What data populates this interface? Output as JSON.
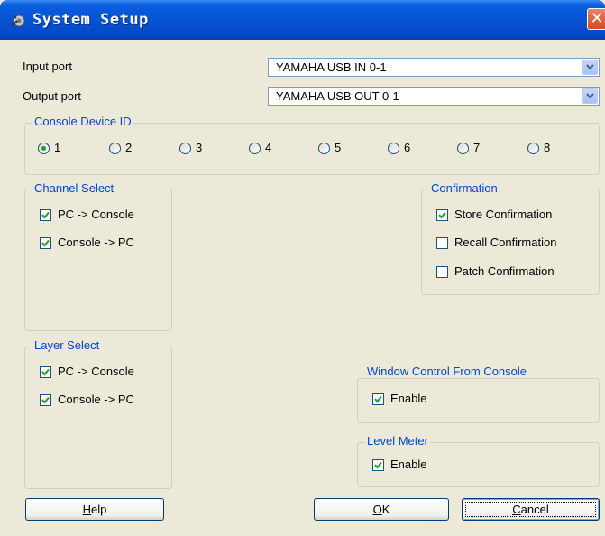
{
  "window": {
    "title": "System Setup",
    "close_glyph": "✕",
    "icon": "system-setup-icon"
  },
  "ports": {
    "input_label": "Input port",
    "input_value": "YAMAHA USB IN 0-1",
    "output_label": "Output port",
    "output_value": "YAMAHA USB OUT 0-1"
  },
  "console_device_id": {
    "title": "Console Device ID",
    "options": [
      "1",
      "2",
      "3",
      "4",
      "5",
      "6",
      "7",
      "8"
    ],
    "selected": "1"
  },
  "channel_select": {
    "title": "Channel Select",
    "items": [
      {
        "label": "PC -> Console",
        "checked": true
      },
      {
        "label": "Console -> PC",
        "checked": true
      }
    ]
  },
  "confirmation": {
    "title": "Confirmation",
    "items": [
      {
        "label": "Store Confirmation",
        "checked": true
      },
      {
        "label": "Recall Confirmation",
        "checked": false
      },
      {
        "label": "Patch Confirmation",
        "checked": false
      }
    ]
  },
  "layer_select": {
    "title": "Layer Select",
    "items": [
      {
        "label": "PC -> Console",
        "checked": true
      },
      {
        "label": "Console -> PC",
        "checked": true
      }
    ]
  },
  "window_control": {
    "title": "Window Control From Console",
    "enable_label": "Enable",
    "checked": true
  },
  "level_meter": {
    "title": "Level Meter",
    "enable_label": "Enable",
    "checked": true
  },
  "buttons": {
    "help_accel": "H",
    "help_rest": "elp",
    "ok_accel": "O",
    "ok_rest": "K",
    "cancel_accel": "C",
    "cancel_rest": "ancel"
  },
  "colors": {
    "group_title": "#0046d5",
    "title_bar": "#0653d4",
    "face": "#ece9d8",
    "check": "#21a121"
  }
}
